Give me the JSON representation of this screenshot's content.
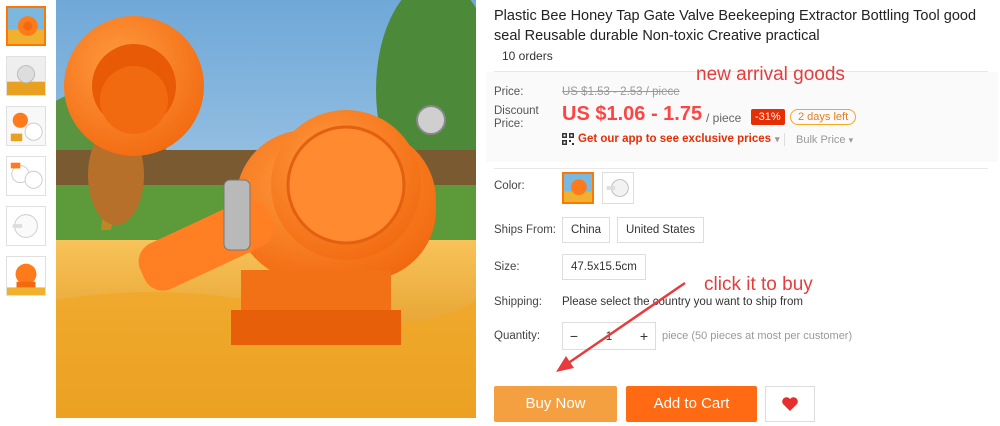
{
  "product": {
    "title": "Plastic Bee Honey Tap Gate Valve Beekeeping Extractor Bottling Tool good seal Reusable durable Non-toxic Creative practical",
    "orders": "10 orders"
  },
  "price": {
    "price_label": "Price:",
    "original": "US $1.53 - 2.53 / piece",
    "discount_label_1": "Discount",
    "discount_label_2": "Price:",
    "discount": "US $1.06 - 1.75",
    "per_piece": "/ piece",
    "discount_badge": "-31%",
    "days_left": "2 days left",
    "app_promo": "Get our app to see exclusive prices",
    "bulk_price": "Bulk Price"
  },
  "annotations": {
    "new_arrival": "new arrival goods",
    "click_to_buy": "click it to buy"
  },
  "options": {
    "color_label": "Color:",
    "ships_from_label": "Ships From:",
    "ships_from": [
      "China",
      "United States"
    ],
    "size_label": "Size:",
    "size": "47.5x15.5cm",
    "shipping_label": "Shipping:",
    "shipping_text": "Please select the country you want to ship from",
    "quantity_label": "Quantity:",
    "quantity_minus": "−",
    "quantity_value": "1",
    "quantity_plus": "+",
    "quantity_note": "piece (50 pieces at most per customer)"
  },
  "actions": {
    "buy_now": "Buy Now",
    "add_to_cart": "Add to Cart"
  },
  "icons": {
    "wishlist": "heart-icon",
    "qr": "qr-code-icon",
    "dropdown": "chevron-down-icon"
  },
  "colors": {
    "accent_red": "#f44444",
    "buy_now": "#f5a040",
    "add_to_cart": "#ff6a13",
    "product_orange": "#ff7a1a"
  }
}
